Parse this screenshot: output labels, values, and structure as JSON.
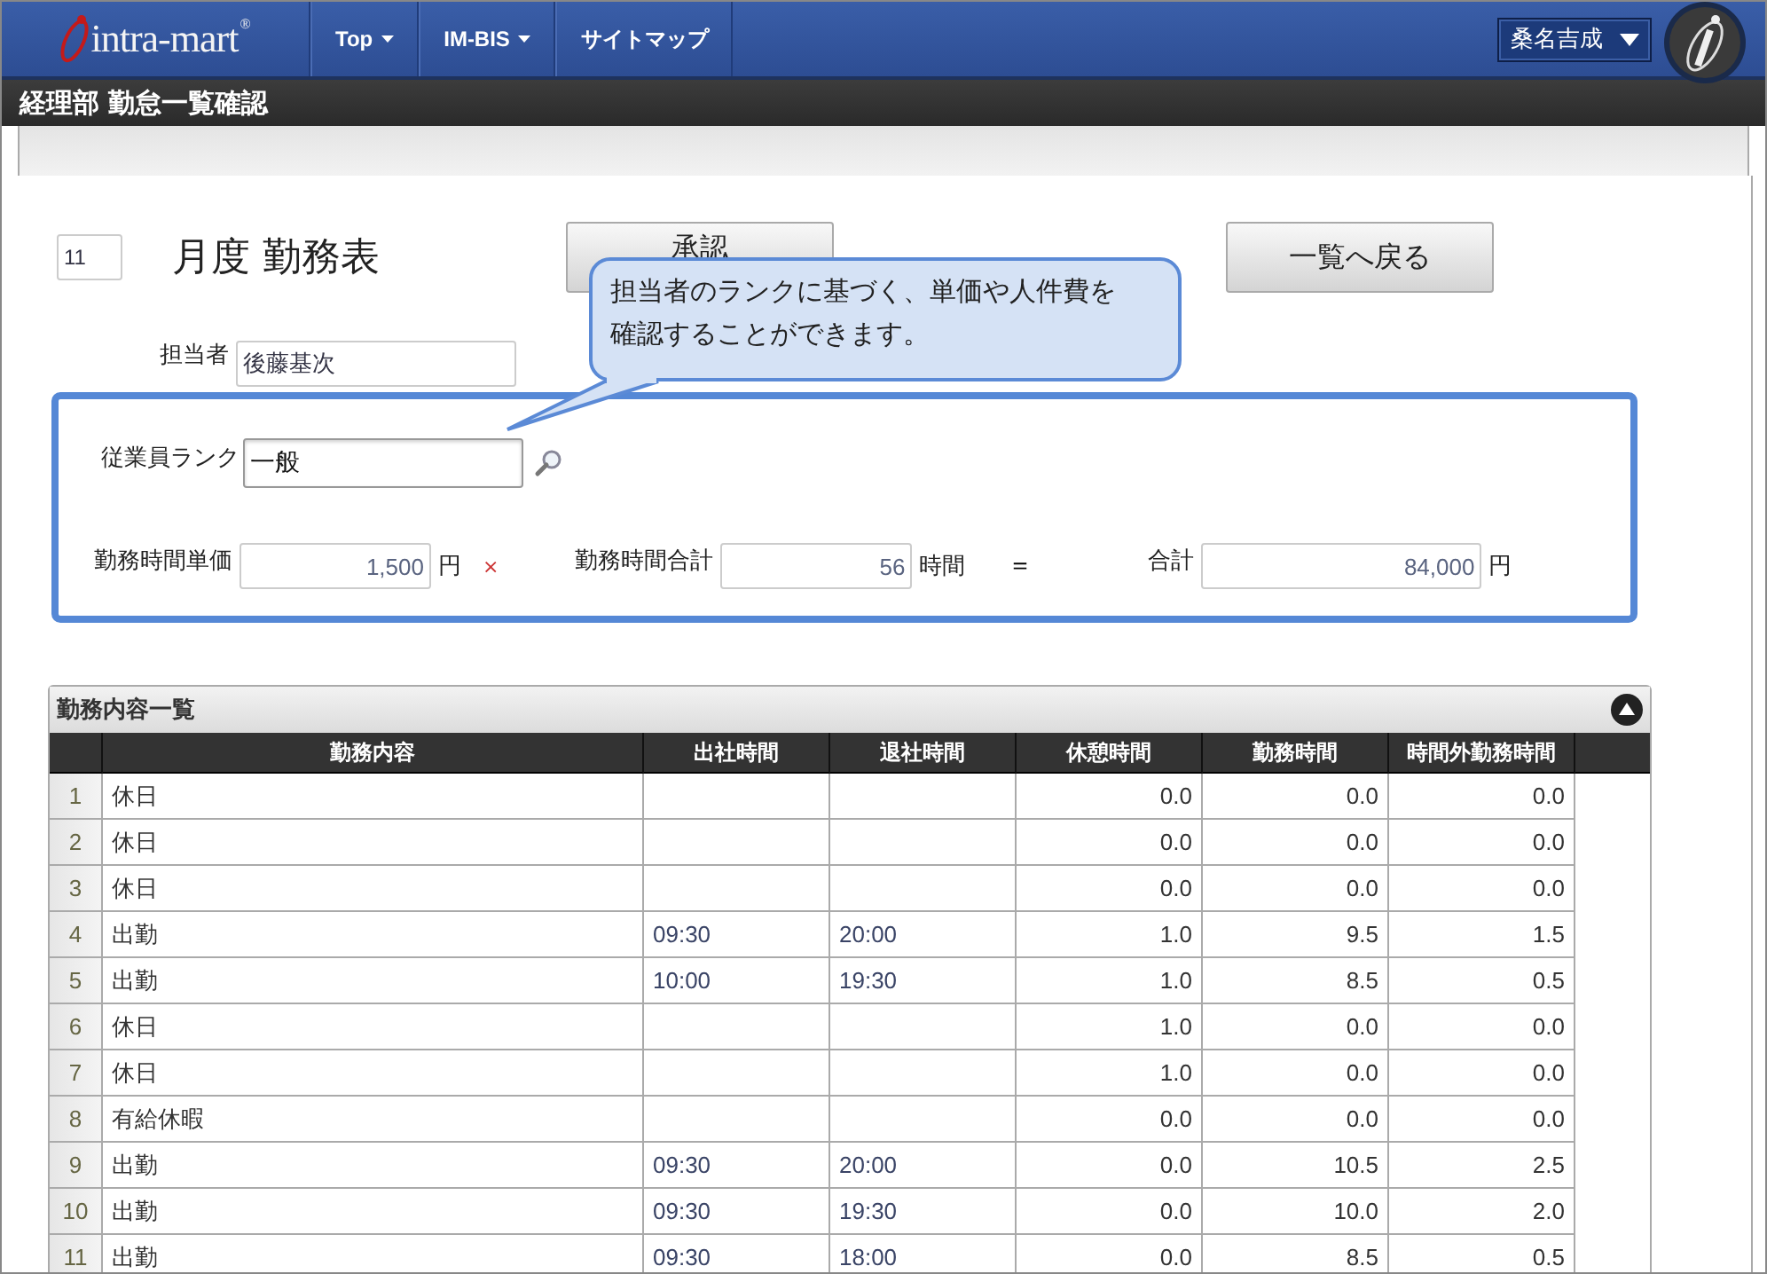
{
  "header": {
    "logo": "intra-mart",
    "logo_mark": "®",
    "menu": [
      {
        "label": "Top",
        "dropdown": true
      },
      {
        "label": "IM-BIS",
        "dropdown": true
      },
      {
        "label": "サイトマップ",
        "dropdown": false
      }
    ],
    "user": "桑名吉成"
  },
  "page_title": "経理部 勤怠一覧確認",
  "form": {
    "month": "11",
    "heading": "月度 勤務表",
    "buttons": [
      {
        "label": "承認"
      },
      {
        "label": "一覧へ戻る"
      }
    ],
    "person": {
      "label": "担当者",
      "value": "後藤基次"
    },
    "callout": [
      "担当者のランクに基づく、単価や人件費を",
      "確認することができます。"
    ],
    "rank": {
      "label": "従業員ランク",
      "value": "一般"
    },
    "calc": [
      {
        "kind": "field",
        "label": "勤務時間単価",
        "value": "1,500",
        "unit": "円"
      },
      {
        "kind": "operator",
        "symbol": "×"
      },
      {
        "kind": "field",
        "label": "勤務時間合計",
        "value": "56",
        "unit": "時間"
      },
      {
        "kind": "operator",
        "symbol": "＝"
      },
      {
        "kind": "field",
        "label": "合計",
        "value": "84,000",
        "unit": "円"
      }
    ]
  },
  "table": {
    "title": "勤務内容一覧",
    "columns": [
      "勤務内容",
      "出社時間",
      "退社時間",
      "休憩時間",
      "勤務時間",
      "時間外勤務時間"
    ],
    "rows": [
      {
        "no": "1",
        "cells": [
          "休日",
          "",
          "",
          "0.0",
          "0.0",
          "0.0"
        ]
      },
      {
        "no": "2",
        "cells": [
          "休日",
          "",
          "",
          "0.0",
          "0.0",
          "0.0"
        ]
      },
      {
        "no": "3",
        "cells": [
          "休日",
          "",
          "",
          "0.0",
          "0.0",
          "0.0"
        ]
      },
      {
        "no": "4",
        "cells": [
          "出勤",
          "09:30",
          "20:00",
          "1.0",
          "9.5",
          "1.5"
        ]
      },
      {
        "no": "5",
        "cells": [
          "出勤",
          "10:00",
          "19:30",
          "1.0",
          "8.5",
          "0.5"
        ]
      },
      {
        "no": "6",
        "cells": [
          "休日",
          "",
          "",
          "1.0",
          "0.0",
          "0.0"
        ]
      },
      {
        "no": "7",
        "cells": [
          "休日",
          "",
          "",
          "1.0",
          "0.0",
          "0.0"
        ]
      },
      {
        "no": "8",
        "cells": [
          "有給休暇",
          "",
          "",
          "0.0",
          "0.0",
          "0.0"
        ]
      },
      {
        "no": "9",
        "cells": [
          "出勤",
          "09:30",
          "20:00",
          "0.0",
          "10.5",
          "2.5"
        ]
      },
      {
        "no": "10",
        "cells": [
          "出勤",
          "09:30",
          "19:30",
          "0.0",
          "10.0",
          "2.0"
        ]
      },
      {
        "no": "11",
        "cells": [
          "出勤",
          "09:30",
          "18:00",
          "0.0",
          "8.5",
          "0.5"
        ]
      }
    ]
  }
}
